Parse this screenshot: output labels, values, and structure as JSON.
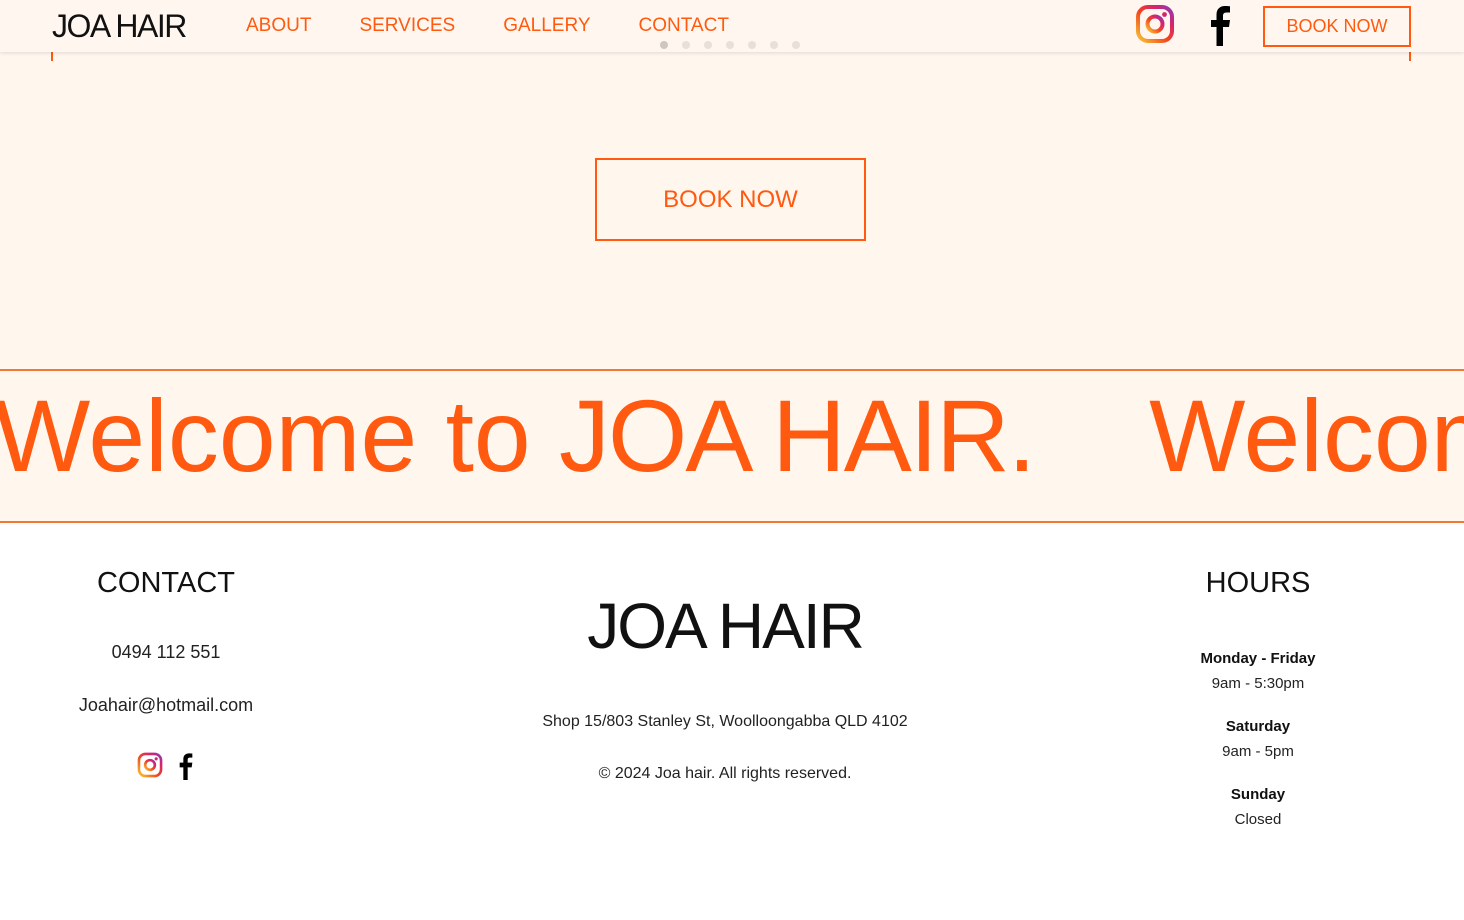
{
  "header": {
    "logo": "JOA HAIR",
    "nav": [
      "ABOUT",
      "SERVICES",
      "GALLERY",
      "CONTACT"
    ],
    "book_label": "BOOK NOW"
  },
  "hero": {
    "book_label": "BOOK NOW"
  },
  "marquee": {
    "bold_text": "Welcome to",
    "light_text": "JOA HAIR."
  },
  "footer": {
    "contact": {
      "heading": "CONTACT",
      "phone": "0494 112 551",
      "email": "Joahair@hotmail.com"
    },
    "center": {
      "logo": "JOA HAIR",
      "address": "Shop 15/803 Stanley St, Woolloongabba QLD 4102",
      "copyright": "© 2024 Joa hair. All rights reserved."
    },
    "hours": {
      "heading": "HOURS",
      "rows": [
        {
          "day": "Monday - Friday",
          "time": "9am - 5:30pm"
        },
        {
          "day": "Saturday",
          "time": "9am - 5pm"
        },
        {
          "day": "Sunday",
          "time": "Closed"
        }
      ]
    }
  },
  "colors": {
    "accent": "#ff5a0f",
    "background": "#fff6ee"
  },
  "icons": [
    "instagram-icon",
    "facebook-icon"
  ]
}
